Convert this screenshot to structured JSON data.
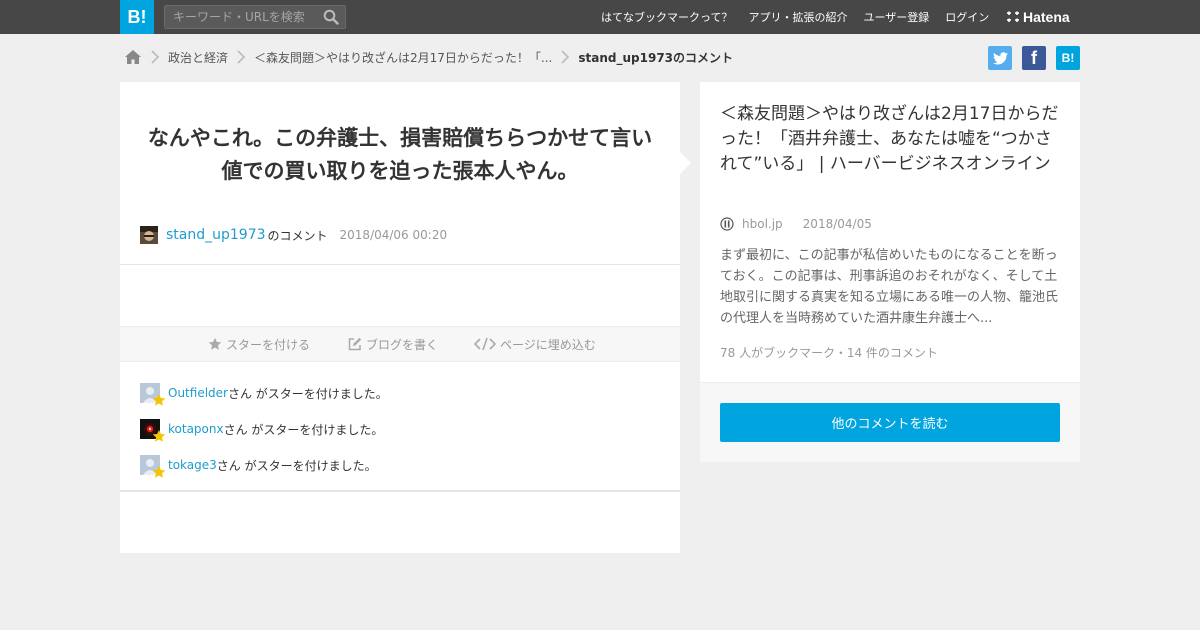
{
  "topbar": {
    "logo": "B!",
    "search_placeholder": "キーワード・URLを検索",
    "nav": [
      "はてなブックマークって？",
      "アプリ・拡張の紹介",
      "ユーザー登録",
      "ログイン"
    ],
    "brand": "Hatena"
  },
  "breadcrumb": {
    "items": [
      "政治と経済",
      "＜森友問題＞やはり改ざんは2月17日からだった！「..."
    ],
    "current": "stand_up1973のコメント"
  },
  "share": {
    "twitter": "t",
    "facebook": "f",
    "hatena": "B!"
  },
  "comment": {
    "text": "なんやこれ。この弁護士、損害賠償ちらつかせて言い値での買い取りを迫った張本人やん。",
    "user": "stand_up1973",
    "suffix": "のコメント",
    "timestamp": "2018/04/06 00:20"
  },
  "actions": {
    "star": "スターを付ける",
    "blog": "ブログを書く",
    "embed": "ページに埋め込む"
  },
  "stars": [
    {
      "user": "Outfielder",
      "text": "さん がスターを付けました。"
    },
    {
      "user": "kotaponx",
      "text": "さん がスターを付けました。"
    },
    {
      "user": "tokage3",
      "text": "さん がスターを付けました。"
    }
  ],
  "article": {
    "title": "＜森友問題＞やはり改ざんは2月17日からだった！「酒井弁護士、あなたは嘘を“つかされて”いる」 | ハーバービジネスオンライン",
    "domain": "hbol.jp",
    "date": "2018/04/05",
    "description": "まず最初に、この記事が私信めいたものになることを断っておく。この記事は、刑事訴追のおそれがなく、そして土地取引に関する真実を知る立場にある唯一の人物、籠池氏の代理人を当時務めていた酒井康生弁護士へ...",
    "count": "78 人がブックマーク・14 件のコメント",
    "read_button": "他のコメントを読む"
  },
  "colors": {
    "topbar": "#474747",
    "brand_blue": "#00a4de",
    "link": "#1f9ccf",
    "twitter": "#55acee",
    "facebook": "#3b5998",
    "star": "#f5c400"
  }
}
